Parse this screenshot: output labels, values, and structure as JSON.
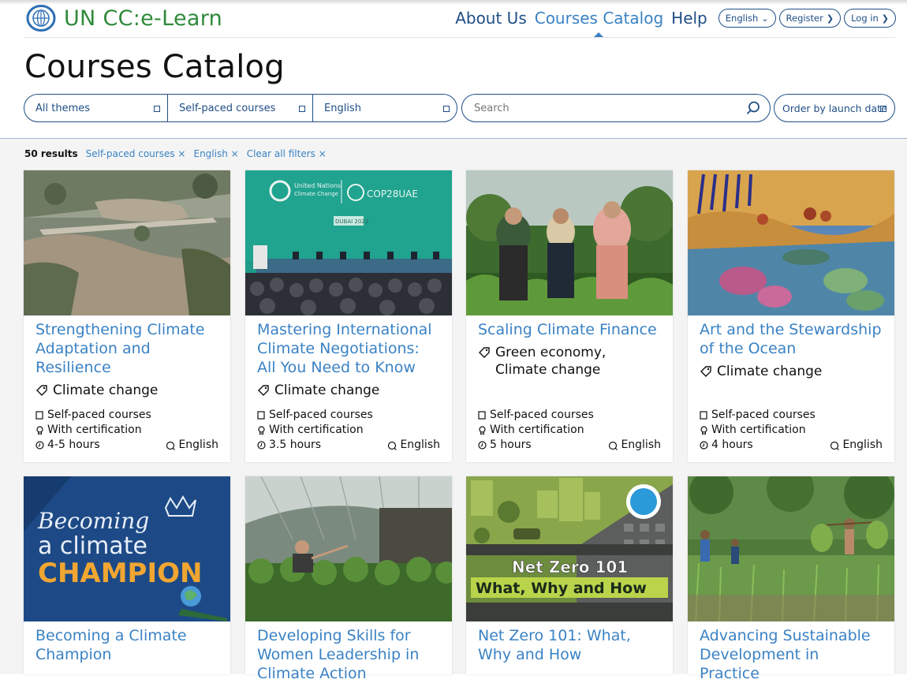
{
  "header": {
    "logo_text": "UN CC:e-Learn",
    "nav": [
      {
        "label": "About Us",
        "active": false
      },
      {
        "label": "Courses Catalog",
        "active": true
      },
      {
        "label": "Help",
        "active": false
      }
    ],
    "language_pill": "English",
    "register_label": "Register",
    "login_label": "Log in"
  },
  "page_title": "Courses Catalog",
  "filters": {
    "theme": "All themes",
    "course_type": "Self-paced courses",
    "language": "English",
    "search_placeholder": "Search",
    "order": "Order by launch date"
  },
  "results": {
    "count": "50 results",
    "chips": [
      "Self-paced courses ×",
      "English ×",
      "Clear all filters ×"
    ]
  },
  "courses": [
    {
      "title": "Strengthening Climate Adaptation and Resilience",
      "tags": "Climate change",
      "type": "Self-paced courses",
      "cert": "With certification",
      "duration": "4-5 hours",
      "language": "English"
    },
    {
      "title": "Mastering International Climate Negotiations: All You Need to Know",
      "tags": "Climate change",
      "type": "Self-paced courses",
      "cert": "With certification",
      "duration": "3.5 hours",
      "language": "English",
      "image_text_1": "United Nations",
      "image_text_2": "Climate Change",
      "image_text_3": "COP28UAE",
      "image_text_4": "DUBAI 2023"
    },
    {
      "title": "Scaling Climate Finance",
      "tags": "Green economy, Climate change",
      "type": "Self-paced courses",
      "cert": "With certification",
      "duration": "5 hours",
      "language": "English"
    },
    {
      "title": "Art and the Stewardship of the Ocean",
      "tags": "Climate change",
      "type": "Self-paced courses",
      "cert": "With certification",
      "duration": "4 hours",
      "language": "English"
    },
    {
      "title": "Becoming a Climate Champion",
      "image_text_1": "Becoming",
      "image_text_2": "a climate",
      "image_text_3": "CHAMPION"
    },
    {
      "title": "Developing Skills for Women Leadership in Climate Action"
    },
    {
      "title": "Net Zero 101: What, Why and How",
      "image_text_1": "Net Zero 101",
      "image_text_2": "What, Why and How"
    },
    {
      "title": "Advancing Sustainable Development in Practice"
    }
  ],
  "colors": {
    "brand_green": "#2f8a3a",
    "link_blue": "#3a82c4",
    "navy": "#1f4e86"
  }
}
